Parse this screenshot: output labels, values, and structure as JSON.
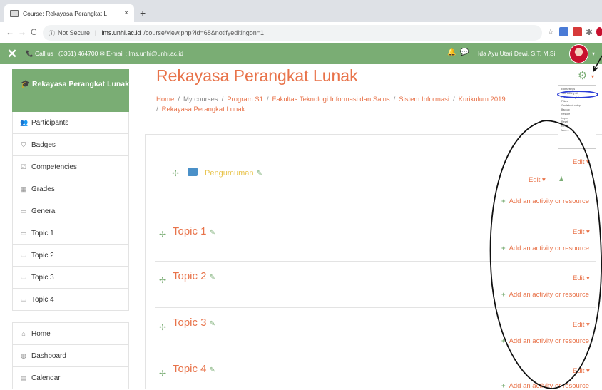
{
  "browser": {
    "tab_title": "Course: Rekayasa Perangkat L",
    "tab_close": "×",
    "new_tab": "+",
    "nav_back": "←",
    "nav_forward": "→",
    "nav_reload": "C",
    "security": "Not Secure",
    "url_host": "lms.unhi.ac.id",
    "url_path": "/course/view.php?id=68&notifyeditingon=1"
  },
  "navbar": {
    "close": "✕",
    "contact": "📞 Call us : (0361) 464700 ✉ E-mail : lms.unhi@unhi.ac.id",
    "bell": "🔔",
    "chat": "💬",
    "user_name": "Ida Ayu Utari Dewi, S.T, M.Si",
    "caret": "▾"
  },
  "sidebar": {
    "active": "Rekayasa Perangkat Lunak",
    "items": [
      {
        "label": "Participants",
        "icon": "👥"
      },
      {
        "label": "Badges",
        "icon": "⛉"
      },
      {
        "label": "Competencies",
        "icon": "☑"
      },
      {
        "label": "Grades",
        "icon": "▦"
      },
      {
        "label": "General",
        "icon": "▭"
      },
      {
        "label": "Topic 1",
        "icon": "▭"
      },
      {
        "label": "Topic 2",
        "icon": "▭"
      },
      {
        "label": "Topic 3",
        "icon": "▭"
      },
      {
        "label": "Topic 4",
        "icon": "▭"
      }
    ],
    "items2": [
      {
        "label": "Home",
        "icon": "⌂"
      },
      {
        "label": "Dashboard",
        "icon": "◍"
      },
      {
        "label": "Calendar",
        "icon": "▤"
      }
    ]
  },
  "main": {
    "course_title": "Rekayasa Perangkat Lunak",
    "breadcrumb": [
      "Home",
      "My courses",
      "Program S1",
      "Fakultas Teknologi Informasi dan Sains",
      "Sistem Informasi",
      "Kurikulum 2019",
      "Rekayasa Perangkat Lunak"
    ],
    "breadcrumb_sep": "/",
    "gear": "⚙",
    "gear_caret": "▾",
    "announcement": "Pengumuman",
    "edit_label": "Edit ▾",
    "add_label": "Add an activity or resource",
    "plus": "+",
    "move": "✢",
    "pencil": "✎",
    "person": "♟",
    "topics": [
      "Topic 1",
      "Topic 2",
      "Topic 3",
      "Topic 4"
    ]
  },
  "gear_menu": {
    "items": [
      "Edit settings",
      "Turn editing off",
      "Course completion",
      "Filters",
      "Gradebook setup",
      "Backup",
      "Restore",
      "Import",
      "Reset",
      "Reset",
      "More..."
    ]
  },
  "colors": {
    "brand_green": "#7aad74",
    "link_orange": "#e8734a",
    "highlight_blue": "#2a3bd6"
  }
}
